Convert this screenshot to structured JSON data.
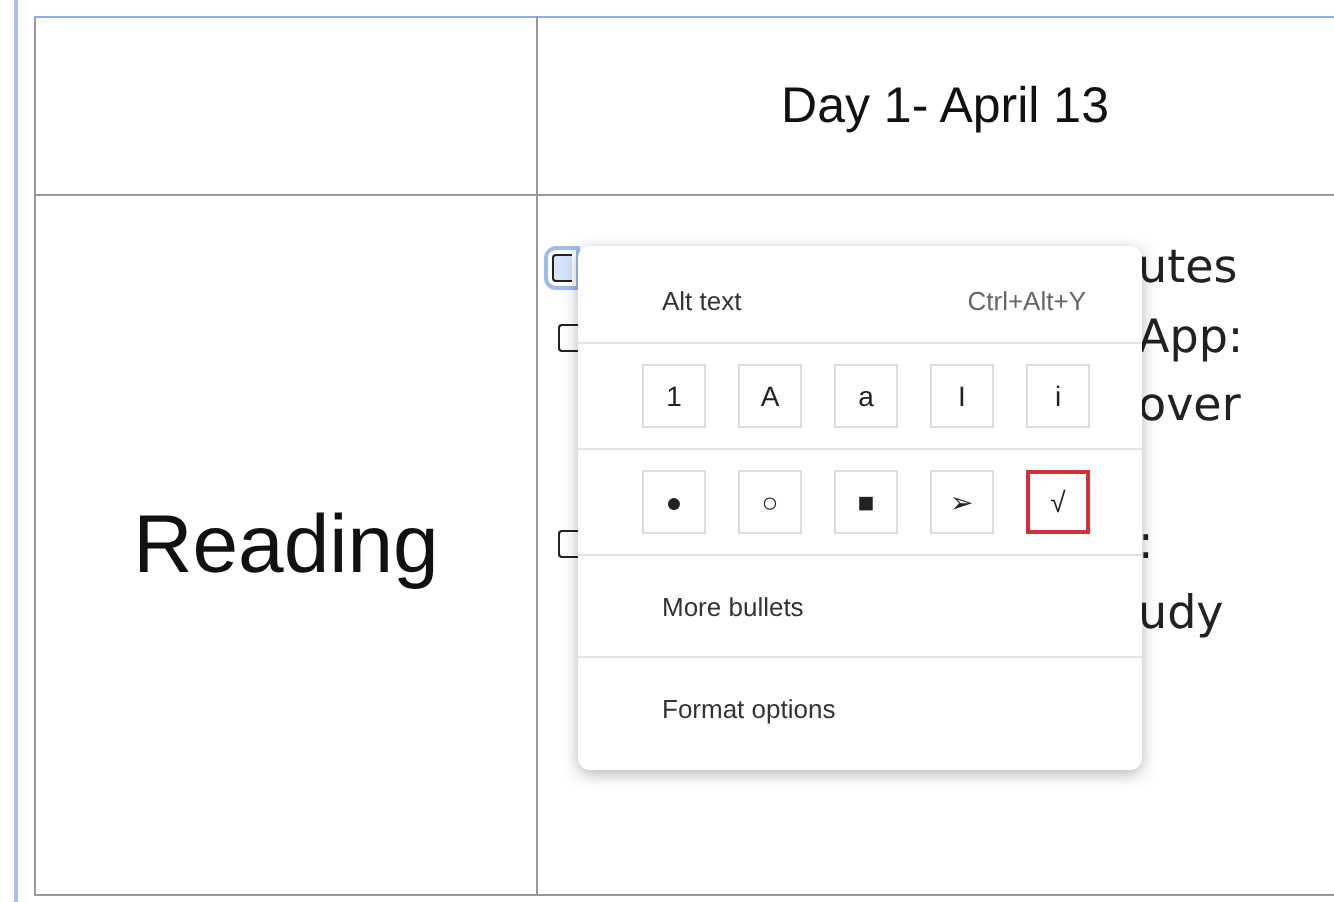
{
  "table": {
    "header": [
      "Day 1- April 13"
    ],
    "row_label": "Reading",
    "cell_lines": [
      {
        "kind": "checkbox",
        "selected": true,
        "text": "utes"
      },
      {
        "kind": "checkbox",
        "selected": false,
        "text": "App:"
      },
      {
        "kind": "plain",
        "text": "over"
      },
      {
        "kind": "blank"
      },
      {
        "kind": "checkbox",
        "selected": false,
        "text": ":"
      },
      {
        "kind": "plain",
        "text": "udy"
      }
    ]
  },
  "menu": {
    "alt_text": {
      "label": "Alt text",
      "shortcut": "Ctrl+Alt+Y"
    },
    "list_styles": [
      {
        "glyph": "1",
        "selected": false
      },
      {
        "glyph": "A",
        "selected": false
      },
      {
        "glyph": "a",
        "selected": false
      },
      {
        "glyph": "I",
        "selected": false
      },
      {
        "glyph": "i",
        "selected": false
      }
    ],
    "bullet_styles": [
      {
        "glyph": "●",
        "selected": false
      },
      {
        "glyph": "○",
        "selected": false
      },
      {
        "glyph": "■",
        "selected": false
      },
      {
        "glyph": "➢",
        "selected": false
      },
      {
        "glyph": "√",
        "selected": true
      }
    ],
    "items": [
      "More bullets",
      "Format options"
    ]
  }
}
